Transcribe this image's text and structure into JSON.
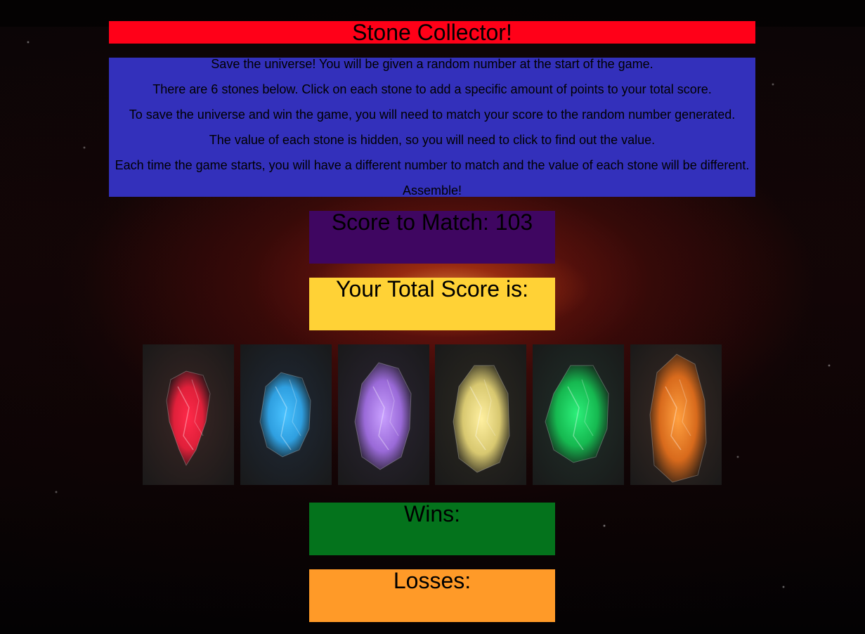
{
  "title": "Stone Collector!",
  "instructions": [
    "Save the universe! You will be given a random number at the start of the game.",
    "There are 6 stones below. Click on each stone to add a specific amount of points to your total score.",
    "To save the universe and win the game, you will need to match your score to the random number generated.",
    "The value of each stone is hidden, so you will need to click to find out the value.",
    "Each time the game starts, you will have a different number to match and the value of each stone will be different.",
    "Assemble!"
  ],
  "target": {
    "label": "Score to Match: 103"
  },
  "total": {
    "label": "Your Total Score is:"
  },
  "stones": [
    {
      "name": "red-stone",
      "color": "#e0203a",
      "glow": "#ff2a4a",
      "bg": "#3a2624"
    },
    {
      "name": "blue-stone",
      "color": "#2f9fe0",
      "glow": "#49c2ff",
      "bg": "#1f2a38"
    },
    {
      "name": "purple-stone",
      "color": "#9a6ad8",
      "glow": "#c9a0ff",
      "bg": "#2b2534"
    },
    {
      "name": "yellow-stone",
      "color": "#d8c870",
      "glow": "#fff0a0",
      "bg": "#2d2a22"
    },
    {
      "name": "green-stone",
      "color": "#16b850",
      "glow": "#2cf07a",
      "bg": "#20302a"
    },
    {
      "name": "orange-stone",
      "color": "#d86a1c",
      "glow": "#ffa040",
      "bg": "#3a2a24"
    }
  ],
  "wins": {
    "label": "Wins:"
  },
  "losses": {
    "label": "Losses:"
  }
}
